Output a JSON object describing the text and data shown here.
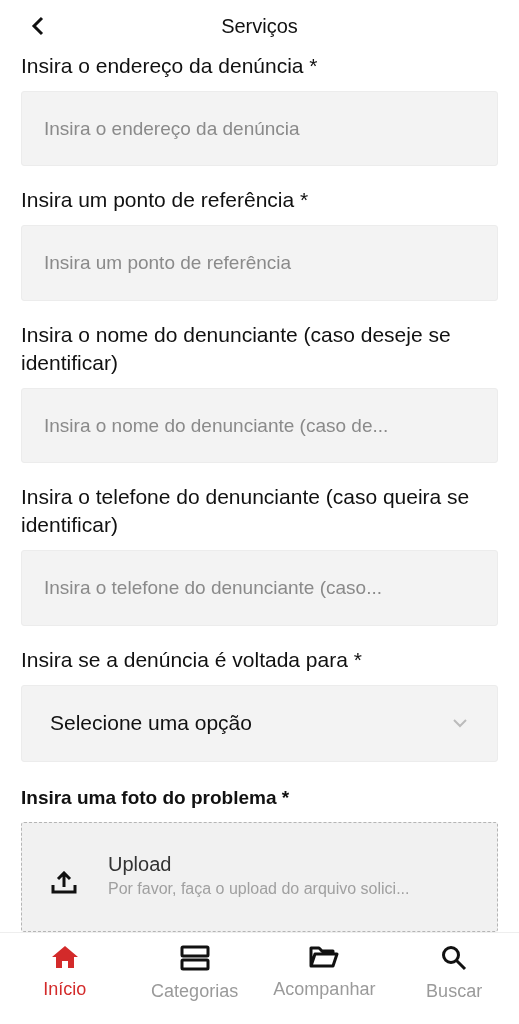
{
  "header": {
    "title": "Serviços"
  },
  "fields": [
    {
      "kind": "text",
      "label": "Insira o endereço da denúncia *",
      "placeholder": "Insira o endereço da denúncia"
    },
    {
      "kind": "text",
      "label": "Insira um ponto de referência *",
      "placeholder": "Insira um ponto de referência"
    },
    {
      "kind": "text",
      "label": "Insira o nome do denunciante (caso deseje se identificar)",
      "placeholder": "Insira o nome do denunciante (caso de..."
    },
    {
      "kind": "text",
      "label": "Insira o telefone do denunciante (caso queira se identificar)",
      "placeholder": "Insira o telefone do denunciante (caso..."
    },
    {
      "kind": "select",
      "label": "Insira se a denúncia é voltada para *",
      "value": "Selecione uma opção"
    },
    {
      "kind": "upload",
      "label": "Insira uma foto do problema *",
      "title": "Upload",
      "hint": "Por favor, faça o upload do arquivo solici..."
    }
  ],
  "tabs": [
    {
      "label": "Início",
      "selected": true
    },
    {
      "label": "Categorias",
      "selected": false
    },
    {
      "label": "Acompanhar",
      "selected": false
    },
    {
      "label": "Buscar",
      "selected": false
    }
  ]
}
